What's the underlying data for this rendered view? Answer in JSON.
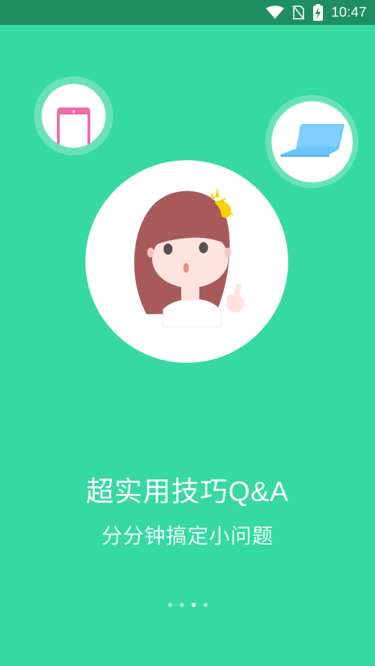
{
  "status_bar": {
    "time": "10:47",
    "icons": [
      "wifi-icon",
      "no-sim-icon",
      "battery-charging-icon"
    ]
  },
  "onboarding": {
    "title": "超实用技巧Q&A",
    "subtitle": "分分钟搞定小问题",
    "illustration": {
      "left_bubble_icon": "phone-icon",
      "right_bubble_icon": "laptop-icon",
      "center": "girl-with-idea-icon"
    },
    "pager": {
      "total": 4,
      "active_index": 2
    }
  },
  "colors": {
    "background": "#37d9a3",
    "status_bar": "#1f8f63",
    "phone": "#f06aa6",
    "laptop": "#6cc6ff",
    "hair": "#a85a5b",
    "spark": "#f7d400"
  }
}
